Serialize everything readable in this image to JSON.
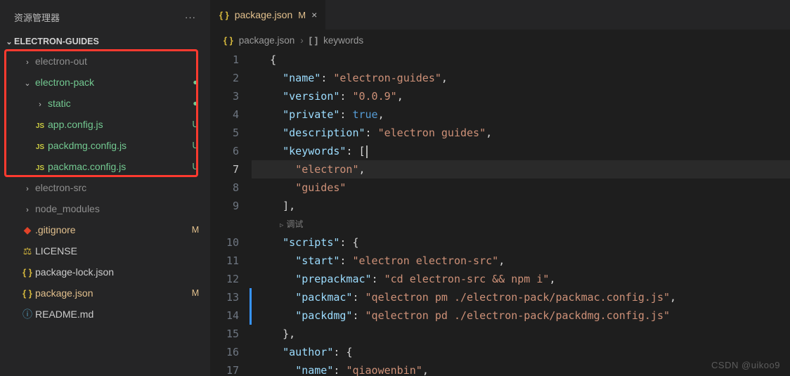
{
  "explorer": {
    "title": "资源管理器",
    "project": "ELECTRON-GUIDES"
  },
  "tree": [
    {
      "kind": "folder",
      "name": "electron-out",
      "open": false,
      "status": "",
      "color": "muted",
      "depth": 1
    },
    {
      "kind": "folder",
      "name": "electron-pack",
      "open": true,
      "status": "●",
      "color": "added",
      "depth": 1
    },
    {
      "kind": "folder",
      "name": "static",
      "open": false,
      "status": "●",
      "color": "added",
      "depth": 2
    },
    {
      "kind": "file",
      "name": "app.config.js",
      "icon": "JS",
      "status": "U",
      "color": "added",
      "depth": 2
    },
    {
      "kind": "file",
      "name": "packdmg.config.js",
      "icon": "JS",
      "status": "U",
      "color": "added",
      "depth": 2
    },
    {
      "kind": "file",
      "name": "packmac.config.js",
      "icon": "JS",
      "status": "U",
      "color": "added",
      "depth": 2
    },
    {
      "kind": "folder",
      "name": "electron-src",
      "open": false,
      "status": "",
      "color": "muted",
      "depth": 1
    },
    {
      "kind": "folder",
      "name": "node_modules",
      "open": false,
      "status": "",
      "color": "muted",
      "depth": 1
    },
    {
      "kind": "file",
      "name": ".gitignore",
      "icon": "git",
      "status": "M",
      "color": "mod",
      "depth": 1
    },
    {
      "kind": "file",
      "name": "LICENSE",
      "icon": "lic",
      "status": "",
      "color": "normal",
      "depth": 1
    },
    {
      "kind": "file",
      "name": "package-lock.json",
      "icon": "json",
      "status": "",
      "color": "normal",
      "depth": 1
    },
    {
      "kind": "file",
      "name": "package.json",
      "icon": "json",
      "status": "M",
      "color": "mod",
      "depth": 1
    },
    {
      "kind": "file",
      "name": "README.md",
      "icon": "info",
      "status": "",
      "color": "normal",
      "depth": 1
    }
  ],
  "tab": {
    "icon": "{ }",
    "label": "package.json",
    "status": "M"
  },
  "breadcrumb": {
    "seg1": "package.json",
    "seg2": "keywords",
    "icon1": "{ }",
    "icon2": "[ ]"
  },
  "codelens": "调试",
  "editor": {
    "current_line": 7,
    "lines": [
      {
        "n": 1,
        "i": 1,
        "t": [
          [
            "p",
            "{"
          ]
        ]
      },
      {
        "n": 2,
        "i": 2,
        "t": [
          [
            "k",
            "\"name\""
          ],
          [
            "p",
            ":"
          ],
          [
            "p",
            " "
          ],
          [
            "s",
            "\"electron-guides\""
          ],
          [
            "p",
            ","
          ]
        ]
      },
      {
        "n": 3,
        "i": 2,
        "t": [
          [
            "k",
            "\"version\""
          ],
          [
            "p",
            ":"
          ],
          [
            "p",
            " "
          ],
          [
            "s",
            "\"0.0.9\""
          ],
          [
            "p",
            ","
          ]
        ]
      },
      {
        "n": 4,
        "i": 2,
        "t": [
          [
            "k",
            "\"private\""
          ],
          [
            "p",
            ":"
          ],
          [
            "p",
            " "
          ],
          [
            "b",
            "true"
          ],
          [
            "p",
            ","
          ]
        ]
      },
      {
        "n": 5,
        "i": 2,
        "t": [
          [
            "k",
            "\"description\""
          ],
          [
            "p",
            ":"
          ],
          [
            "p",
            " "
          ],
          [
            "s",
            "\"electron guides\""
          ],
          [
            "p",
            ","
          ]
        ]
      },
      {
        "n": 6,
        "i": 2,
        "t": [
          [
            "k",
            "\"keywords\""
          ],
          [
            "p",
            ":"
          ],
          [
            "p",
            " "
          ],
          [
            "p",
            "["
          ]
        ],
        "cursor": true
      },
      {
        "n": 7,
        "i": 3,
        "t": [
          [
            "s",
            "\"electron\""
          ],
          [
            "p",
            ","
          ]
        ]
      },
      {
        "n": 8,
        "i": 3,
        "t": [
          [
            "s",
            "\"guides\""
          ]
        ]
      },
      {
        "n": 9,
        "i": 2,
        "t": [
          [
            "p",
            "]"
          ],
          [
            "p",
            ","
          ]
        ]
      },
      {
        "n": 10,
        "i": 2,
        "t": [
          [
            "k",
            "\"scripts\""
          ],
          [
            "p",
            ":"
          ],
          [
            "p",
            " "
          ],
          [
            "p",
            "{"
          ]
        ]
      },
      {
        "n": 11,
        "i": 3,
        "t": [
          [
            "k",
            "\"start\""
          ],
          [
            "p",
            ":"
          ],
          [
            "p",
            " "
          ],
          [
            "s",
            "\"electron electron-src\""
          ],
          [
            "p",
            ","
          ]
        ]
      },
      {
        "n": 12,
        "i": 3,
        "t": [
          [
            "k",
            "\"prepackmac\""
          ],
          [
            "p",
            ":"
          ],
          [
            "p",
            " "
          ],
          [
            "s",
            "\"cd electron-src && npm i\""
          ],
          [
            "p",
            ","
          ]
        ]
      },
      {
        "n": 13,
        "i": 3,
        "diff": true,
        "t": [
          [
            "k",
            "\"packmac\""
          ],
          [
            "p",
            ":"
          ],
          [
            "p",
            " "
          ],
          [
            "s",
            "\"qelectron pm ./electron-pack/packmac.config.js\""
          ],
          [
            "p",
            ","
          ]
        ]
      },
      {
        "n": 14,
        "i": 3,
        "diff": true,
        "t": [
          [
            "k",
            "\"packdmg\""
          ],
          [
            "p",
            ":"
          ],
          [
            "p",
            " "
          ],
          [
            "s",
            "\"qelectron pd ./electron-pack/packdmg.config.js\""
          ]
        ]
      },
      {
        "n": 15,
        "i": 2,
        "t": [
          [
            "p",
            "}"
          ],
          [
            "p",
            ","
          ]
        ]
      },
      {
        "n": 16,
        "i": 2,
        "t": [
          [
            "k",
            "\"author\""
          ],
          [
            "p",
            ":"
          ],
          [
            "p",
            " "
          ],
          [
            "p",
            "{"
          ]
        ]
      },
      {
        "n": 17,
        "i": 3,
        "t": [
          [
            "k",
            "\"name\""
          ],
          [
            "p",
            ":"
          ],
          [
            "p",
            " "
          ],
          [
            "s",
            "\"qiaowenbin\""
          ],
          [
            "p",
            ","
          ]
        ]
      }
    ]
  },
  "watermark": "CSDN @uikoo9"
}
